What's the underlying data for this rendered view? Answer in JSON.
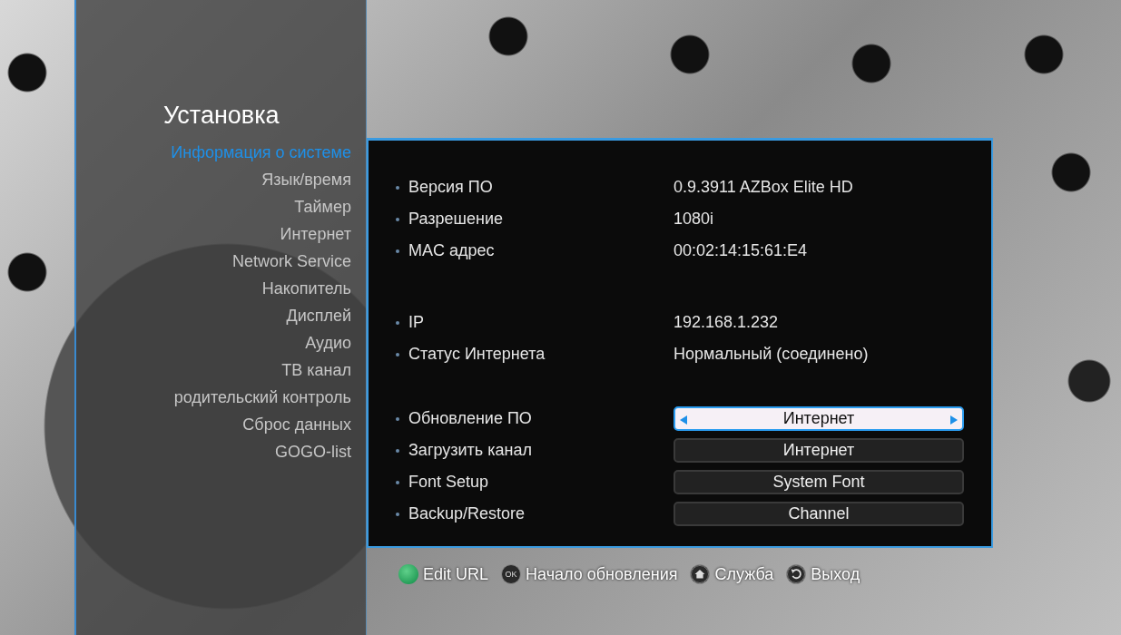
{
  "sidebar": {
    "title": "Установка",
    "items": [
      {
        "label": "Информация о системе",
        "selected": true
      },
      {
        "label": "Язык/время",
        "selected": false
      },
      {
        "label": "Таймер",
        "selected": false
      },
      {
        "label": "Интернет",
        "selected": false
      },
      {
        "label": "Network Service",
        "selected": false
      },
      {
        "label": "Накопитель",
        "selected": false
      },
      {
        "label": "Дисплей",
        "selected": false
      },
      {
        "label": "Аудио",
        "selected": false
      },
      {
        "label": "ТВ канал",
        "selected": false
      },
      {
        "label": "родительский контроль",
        "selected": false
      },
      {
        "label": "Сброс данных",
        "selected": false
      },
      {
        "label": "GOGO-list",
        "selected": false
      }
    ]
  },
  "info_groups": [
    [
      {
        "label": "Версия ПО",
        "value": "0.9.3911 AZBox Elite HD"
      },
      {
        "label": "Разрешение",
        "value": "1080i"
      },
      {
        "label": "MAC адрес",
        "value": "00:02:14:15:61:E4"
      }
    ],
    [
      {
        "label": "IP",
        "value": "192.168.1.232"
      },
      {
        "label": "Статус Интернета",
        "value": "Нормальный (соединено)"
      }
    ]
  ],
  "options": [
    {
      "label": "Обновление ПО",
      "value": "Интернет",
      "selected": true
    },
    {
      "label": "Загрузить канал",
      "value": "Интернет",
      "selected": false
    },
    {
      "label": "Font Setup",
      "value": "System Font",
      "selected": false
    },
    {
      "label": "Backup/Restore",
      "value": "Channel",
      "selected": false
    }
  ],
  "footer": [
    {
      "kind": "green",
      "label": "Edit URL"
    },
    {
      "kind": "ok",
      "key": "OK",
      "label": "Начало обновления"
    },
    {
      "kind": "home",
      "label": "Служба"
    },
    {
      "kind": "back",
      "label": "Выход"
    }
  ]
}
